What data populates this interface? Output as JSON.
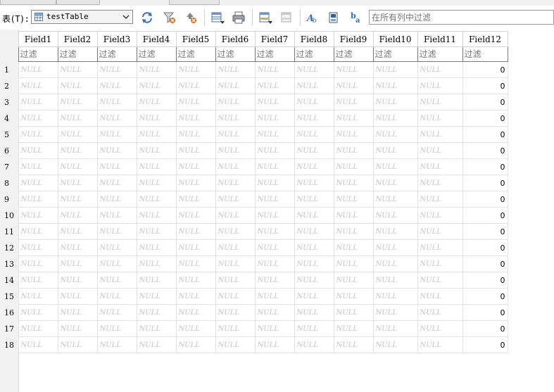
{
  "toolbar": {
    "table_label": "表(T):",
    "selected_table": "testTable",
    "filter_all_placeholder": "在所有列中过滤",
    "buttons": [
      {
        "name": "refresh-button",
        "icon": "refresh-icon"
      },
      {
        "name": "clear-filter-button",
        "icon": "clear-filter-icon"
      },
      {
        "name": "clear-sort-button",
        "icon": "clear-sort-icon"
      },
      {
        "name": "save-table-as-button",
        "icon": "save-table-icon"
      },
      {
        "name": "print-button",
        "icon": "print-icon"
      },
      {
        "name": "new-record-button",
        "icon": "new-record-icon"
      },
      {
        "name": "delete-record-button",
        "icon": "delete-record-icon"
      },
      {
        "name": "find-replace-button",
        "icon": "find-icon"
      },
      {
        "name": "sql-export-button",
        "icon": "sql-icon"
      },
      {
        "name": "text-format-button",
        "icon": "text-format-icon"
      }
    ]
  },
  "grid": {
    "columns": [
      "Field1",
      "Field2",
      "Field3",
      "Field4",
      "Field5",
      "Field6",
      "Field7",
      "Field8",
      "Field9",
      "Field10",
      "Field11",
      "Field12"
    ],
    "filter_placeholder": "过滤",
    "null_text": "NULL",
    "rows": [
      {
        "num": "1",
        "last": "0"
      },
      {
        "num": "2",
        "last": "0"
      },
      {
        "num": "3",
        "last": "0"
      },
      {
        "num": "4",
        "last": "0"
      },
      {
        "num": "5",
        "last": "0"
      },
      {
        "num": "6",
        "last": "0"
      },
      {
        "num": "7",
        "last": "0"
      },
      {
        "num": "8",
        "last": "0"
      },
      {
        "num": "9",
        "last": "0"
      },
      {
        "num": "10",
        "last": "0"
      },
      {
        "num": "11",
        "last": "0"
      },
      {
        "num": "12",
        "last": "0"
      },
      {
        "num": "13",
        "last": "0"
      },
      {
        "num": "14",
        "last": "0"
      },
      {
        "num": "15",
        "last": "0"
      },
      {
        "num": "16",
        "last": "0"
      },
      {
        "num": "17",
        "last": "0"
      },
      {
        "num": "18",
        "last": "0"
      }
    ]
  },
  "colors": {
    "null_text": "#c4c4c4",
    "row_header_bg": "#f2f2f2",
    "accent": "#2f6fc4"
  }
}
